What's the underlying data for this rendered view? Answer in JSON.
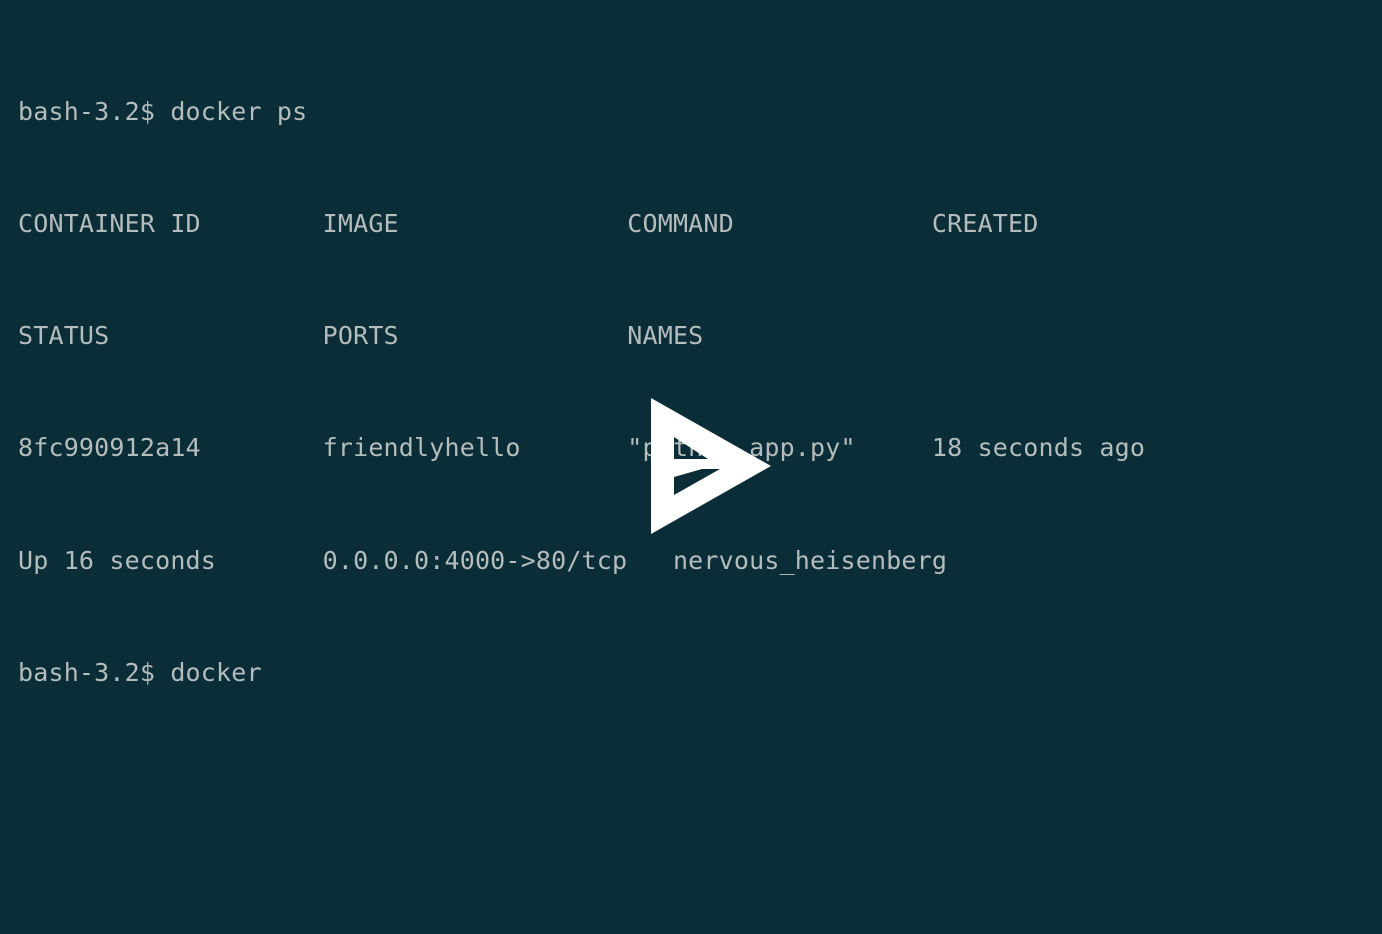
{
  "terminal": {
    "background_color": "#0a2d38",
    "text_color": "#b4bcbc",
    "prompt": "bash-3.2$",
    "lines": [
      "bash-3.2$ docker ps",
      "CONTAINER ID        IMAGE               COMMAND             CREATED",
      "STATUS              PORTS               NAMES",
      "8fc990912a14        friendlyhello       \"python app.py\"     18 seconds ago",
      "Up 16 seconds       0.0.0.0:4000->80/tcp   nervous_heisenberg",
      "bash-3.2$ docker"
    ],
    "commands": [
      "docker ps",
      "docker"
    ],
    "docker_ps": {
      "headers": [
        "CONTAINER ID",
        "IMAGE",
        "COMMAND",
        "CREATED",
        "STATUS",
        "PORTS",
        "NAMES"
      ],
      "rows": [
        {
          "container_id": "8fc990912a14",
          "image": "friendlyhello",
          "command": "\"python app.py\"",
          "created": "18 seconds ago",
          "status": "Up 16 seconds",
          "ports": "0.0.0.0:4000->80/tcp",
          "names": "nervous_heisenberg"
        }
      ]
    }
  },
  "player": {
    "play_button_label": "Play",
    "play_button_color": "#ffffff"
  }
}
